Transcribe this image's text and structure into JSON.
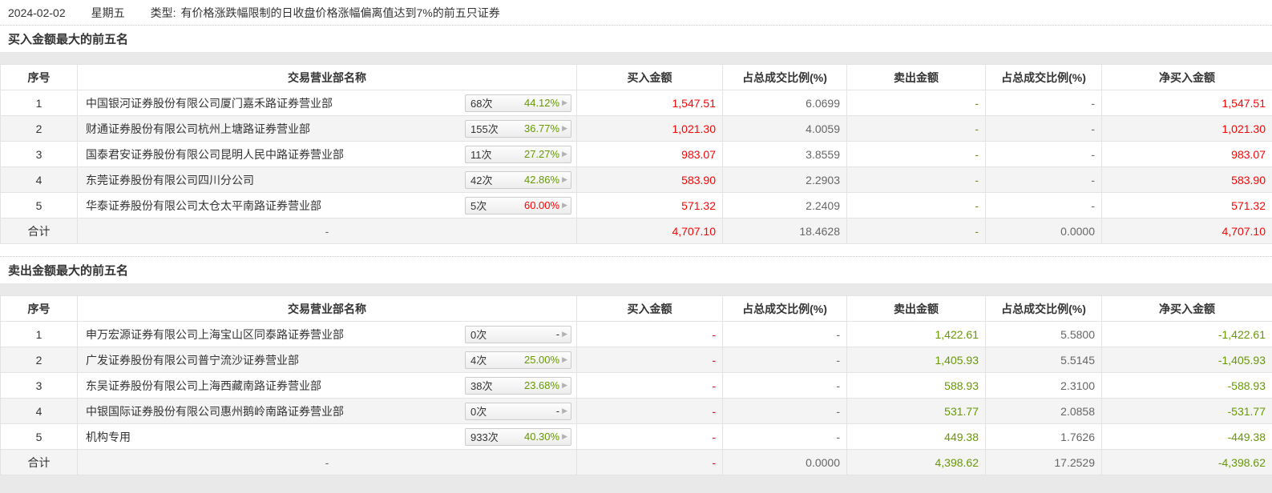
{
  "page": {
    "date": "2024-02-02",
    "weekday": "星期五",
    "type_label": "类型:",
    "type_text": "有价格涨跌幅限制的日收盘价格涨幅偏离值达到7%的前五只证券"
  },
  "colors": {
    "red": "#ff0000",
    "green": "#669900",
    "gray": "#666666",
    "badge_neutral": "#333333"
  },
  "table_headers": {
    "rank": "序号",
    "name": "交易营业部名称",
    "buy": "买入金额",
    "buy_ratio": "占总成交比例(%)",
    "sell": "卖出金额",
    "sell_ratio": "占总成交比例(%)",
    "net": "净买入金额"
  },
  "buy_section": {
    "title": "买入金额最大的前五名",
    "rows": [
      {
        "rank": "1",
        "name": "中国银河证券股份有限公司厦门嘉禾路证券营业部",
        "badge_count": "68次",
        "badge_pct": "44.12%",
        "pct_color": "#669900",
        "buy": "1,547.51",
        "buy_ratio": "6.0699",
        "sell": "-",
        "sell_ratio": "-",
        "net": "1,547.51"
      },
      {
        "rank": "2",
        "name": "财通证券股份有限公司杭州上塘路证券营业部",
        "badge_count": "155次",
        "badge_pct": "36.77%",
        "pct_color": "#669900",
        "buy": "1,021.30",
        "buy_ratio": "4.0059",
        "sell": "-",
        "sell_ratio": "-",
        "net": "1,021.30"
      },
      {
        "rank": "3",
        "name": "国泰君安证券股份有限公司昆明人民中路证券营业部",
        "badge_count": "11次",
        "badge_pct": "27.27%",
        "pct_color": "#669900",
        "buy": "983.07",
        "buy_ratio": "3.8559",
        "sell": "-",
        "sell_ratio": "-",
        "net": "983.07"
      },
      {
        "rank": "4",
        "name": "东莞证券股份有限公司四川分公司",
        "badge_count": "42次",
        "badge_pct": "42.86%",
        "pct_color": "#669900",
        "buy": "583.90",
        "buy_ratio": "2.2903",
        "sell": "-",
        "sell_ratio": "-",
        "net": "583.90"
      },
      {
        "rank": "5",
        "name": "华泰证券股份有限公司太仓太平南路证券营业部",
        "badge_count": "5次",
        "badge_pct": "60.00%",
        "pct_color": "#ff0000",
        "buy": "571.32",
        "buy_ratio": "2.2409",
        "sell": "-",
        "sell_ratio": "-",
        "net": "571.32"
      }
    ],
    "total": {
      "rank": "合计",
      "name": "-",
      "buy": "4,707.10",
      "buy_ratio": "18.4628",
      "sell": "-",
      "sell_ratio": "0.0000",
      "net": "4,707.10"
    }
  },
  "sell_section": {
    "title": "卖出金额最大的前五名",
    "rows": [
      {
        "rank": "1",
        "name": "申万宏源证券有限公司上海宝山区同泰路证券营业部",
        "badge_count": "0次",
        "badge_pct": "-",
        "pct_color": "#333333",
        "buy": "-",
        "buy_ratio": "-",
        "sell": "1,422.61",
        "sell_ratio": "5.5800",
        "net": "-1,422.61"
      },
      {
        "rank": "2",
        "name": "广发证券股份有限公司普宁流沙证券营业部",
        "badge_count": "4次",
        "badge_pct": "25.00%",
        "pct_color": "#669900",
        "buy": "-",
        "buy_ratio": "-",
        "sell": "1,405.93",
        "sell_ratio": "5.5145",
        "net": "-1,405.93"
      },
      {
        "rank": "3",
        "name": "东吴证券股份有限公司上海西藏南路证券营业部",
        "badge_count": "38次",
        "badge_pct": "23.68%",
        "pct_color": "#669900",
        "buy": "-",
        "buy_ratio": "-",
        "sell": "588.93",
        "sell_ratio": "2.3100",
        "net": "-588.93"
      },
      {
        "rank": "4",
        "name": "中银国际证券股份有限公司惠州鹅岭南路证券营业部",
        "badge_count": "0次",
        "badge_pct": "-",
        "pct_color": "#333333",
        "buy": "-",
        "buy_ratio": "-",
        "sell": "531.77",
        "sell_ratio": "2.0858",
        "net": "-531.77"
      },
      {
        "rank": "5",
        "name": "机构专用",
        "badge_count": "933次",
        "badge_pct": "40.30%",
        "pct_color": "#669900",
        "buy": "-",
        "buy_ratio": "-",
        "sell": "449.38",
        "sell_ratio": "1.7626",
        "net": "-449.38"
      }
    ],
    "total": {
      "rank": "合计",
      "name": "-",
      "buy": "-",
      "buy_ratio": "0.0000",
      "sell": "4,398.62",
      "sell_ratio": "17.2529",
      "net": "-4,398.62"
    }
  }
}
